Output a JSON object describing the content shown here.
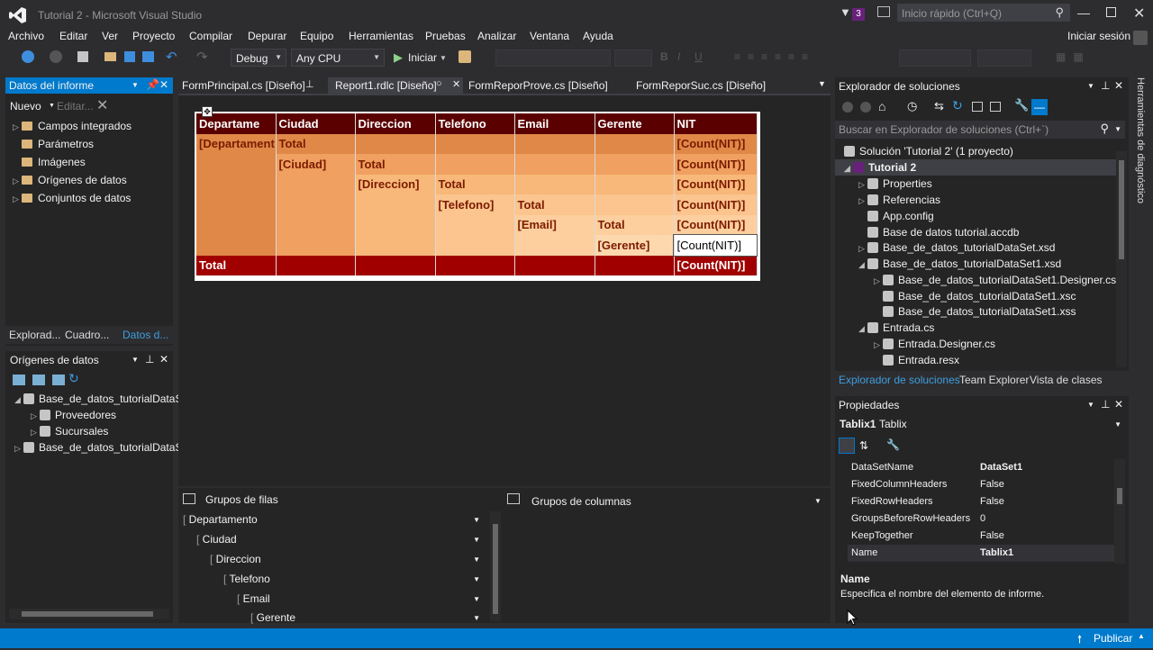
{
  "titlebar": {
    "title": "Tutorial 2 - Microsoft Visual Studio",
    "notif": "3",
    "quicklaunch": "Inicio rápido (Ctrl+Q)"
  },
  "menu": [
    "Archivo",
    "Editar",
    "Ver",
    "Proyecto",
    "Compilar",
    "Depurar",
    "Equipo",
    "Herramientas",
    "Pruebas",
    "Analizar",
    "Ventana",
    "Ayuda"
  ],
  "signin": "Iniciar sesión",
  "toolbar": {
    "config": "Debug",
    "platform": "Any CPU",
    "start": "Iniciar"
  },
  "leftpanel": {
    "title": "Datos del informe",
    "new": "Nuevo",
    "edit": "Editar...",
    "items": [
      "Campos integrados",
      "Parámetros",
      "Imágenes",
      "Orígenes de datos",
      "Conjuntos de datos"
    ],
    "tabs": [
      "Explorad...",
      "Cuadro...",
      "Datos d..."
    ]
  },
  "datasources": {
    "title": "Orígenes de datos",
    "items": [
      "Base_de_datos_tutorialDataSe",
      "Proveedores",
      "Sucursales",
      "Base_de_datos_tutorialDataSe"
    ]
  },
  "doctabs": [
    "FormPrincipal.cs [Diseño]",
    "Report1.rdlc [Diseño]",
    "FormReporProve.cs [Diseño]",
    "FormReporSuc.cs [Diseño]"
  ],
  "report": {
    "headers": [
      "Departame",
      "Ciudad",
      "Direccion",
      "Telefono",
      "Email",
      "Gerente",
      "NIT"
    ],
    "rows": [
      [
        "[Departament",
        "Total",
        "",
        "",
        "",
        "",
        "[Count(NIT)]"
      ],
      [
        "",
        "[Ciudad]",
        "Total",
        "",
        "",
        "",
        "[Count(NIT)]"
      ],
      [
        "",
        "",
        "[Direccion]",
        "Total",
        "",
        "",
        "[Count(NIT)]"
      ],
      [
        "",
        "",
        "",
        "[Telefono]",
        "Total",
        "",
        "[Count(NIT)]"
      ],
      [
        "",
        "",
        "",
        "",
        "[Email]",
        "Total",
        "[Count(NIT)]"
      ],
      [
        "",
        "",
        "",
        "",
        "",
        "[Gerente]",
        "[Count(NIT)]"
      ]
    ],
    "total": [
      "Total",
      "",
      "",
      "",
      "",
      "",
      "[Count(NIT)]"
    ]
  },
  "groups": {
    "rows_title": "Grupos de filas",
    "cols_title": "Grupos de columnas",
    "rows": [
      "Departamento",
      "Ciudad",
      "Direccion",
      "Telefono",
      "Email",
      "Gerente"
    ]
  },
  "solution": {
    "title": "Explorador de soluciones",
    "search": "Buscar en Explorador de soluciones (Ctrl+`)",
    "items": [
      "Solución 'Tutorial 2'  (1 proyecto)",
      "Tutorial 2",
      "Properties",
      "Referencias",
      "App.config",
      "Base de datos tutorial.accdb",
      "Base_de_datos_tutorialDataSet.xsd",
      "Base_de_datos_tutorialDataSet1.xsd",
      "Base_de_datos_tutorialDataSet1.Designer.cs",
      "Base_de_datos_tutorialDataSet1.xsc",
      "Base_de_datos_tutorialDataSet1.xss",
      "Entrada.cs",
      "Entrada.Designer.cs",
      "Entrada.resx"
    ],
    "tabs": [
      "Explorador de soluciones",
      "Team Explorer",
      "Vista de clases"
    ]
  },
  "properties": {
    "title": "Propiedades",
    "object": "Tablix1",
    "type": "Tablix",
    "rows": [
      [
        "DataSetName",
        "DataSet1"
      ],
      [
        "FixedColumnHeaders",
        "False"
      ],
      [
        "FixedRowHeaders",
        "False"
      ],
      [
        "GroupsBeforeRowHeaders",
        "0"
      ],
      [
        "KeepTogether",
        "False"
      ],
      [
        "Name",
        "Tablix1"
      ]
    ],
    "desc_title": "Name",
    "desc": "Especifica el nombre del elemento de informe."
  },
  "sidetab": "Herramientas de diagnóstico",
  "status": {
    "publish": "Publicar"
  }
}
